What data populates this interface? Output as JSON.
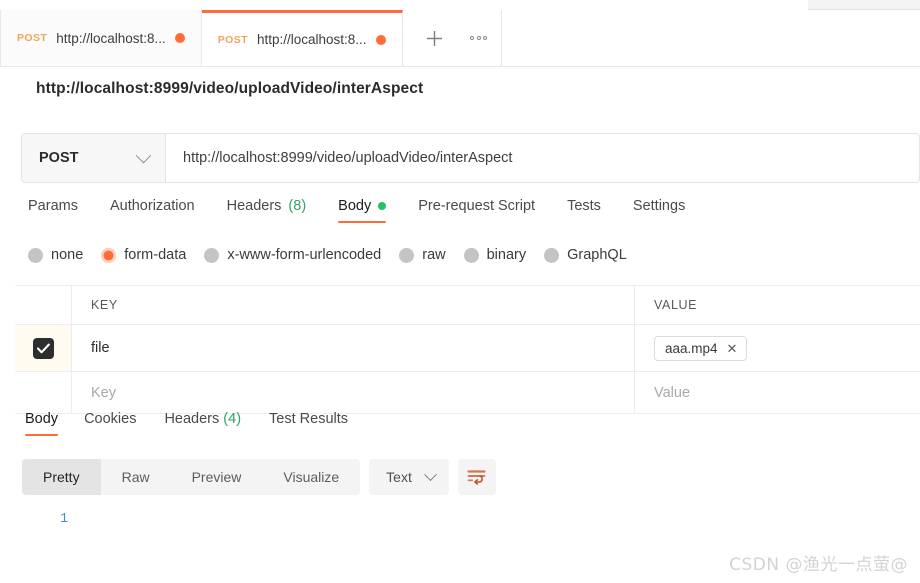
{
  "tabs": [
    {
      "method": "POST",
      "url": "http://localhost:8...",
      "unsaved": true,
      "active": false
    },
    {
      "method": "POST",
      "url": "http://localhost:8...",
      "unsaved": true,
      "active": true
    }
  ],
  "tab_actions": {
    "new_tab": "+",
    "more": "•••"
  },
  "request": {
    "title": "http://localhost:8999/video/uploadVideo/interAspect",
    "method": "POST",
    "url": "http://localhost:8999/video/uploadVideo/interAspect",
    "tabs": [
      {
        "label": "Params",
        "active": false
      },
      {
        "label": "Authorization",
        "active": false
      },
      {
        "label": "Headers",
        "count": "(8)",
        "active": false
      },
      {
        "label": "Body",
        "active": true,
        "dot": true
      },
      {
        "label": "Pre-request Script",
        "active": false
      },
      {
        "label": "Tests",
        "active": false
      },
      {
        "label": "Settings",
        "active": false
      }
    ],
    "body_types": [
      {
        "label": "none",
        "selected": false
      },
      {
        "label": "form-data",
        "selected": true
      },
      {
        "label": "x-www-form-urlencoded",
        "selected": false
      },
      {
        "label": "raw",
        "selected": false
      },
      {
        "label": "binary",
        "selected": false
      },
      {
        "label": "GraphQL",
        "selected": false
      }
    ],
    "table": {
      "headers": {
        "key": "KEY",
        "value": "VALUE"
      },
      "rows": [
        {
          "checked": true,
          "key": "file",
          "value": "aaa.mp4",
          "remove": "✕"
        }
      ],
      "placeholder": {
        "key": "Key",
        "value": "Value"
      }
    }
  },
  "response": {
    "tabs": [
      {
        "label": "Body",
        "active": true
      },
      {
        "label": "Cookies",
        "active": false
      },
      {
        "label": "Headers",
        "count": "(4)",
        "active": false
      },
      {
        "label": "Test Results",
        "active": false
      }
    ],
    "view_modes": [
      {
        "label": "Pretty",
        "active": true
      },
      {
        "label": "Raw",
        "active": false
      },
      {
        "label": "Preview",
        "active": false
      },
      {
        "label": "Visualize",
        "active": false
      }
    ],
    "format": "Text",
    "line_numbers": [
      "1"
    ],
    "content": ""
  },
  "watermark": "CSDN @渔光一点萤@",
  "colors": {
    "accent": "#ff6c37",
    "green": "#23c16b",
    "method": "#f0a45b",
    "linenum": "#4a90b8"
  }
}
